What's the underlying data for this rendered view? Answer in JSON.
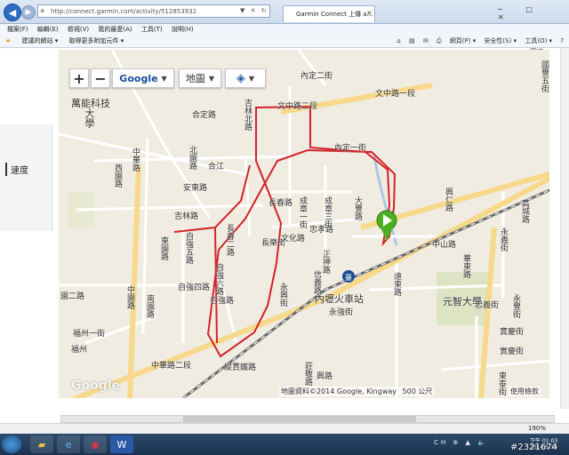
{
  "browser": {
    "address": "http://connect.garmin.com/activity/512853932",
    "tab_title": "Garmin Connect 上傳 a...",
    "tab_close": "×",
    "window_controls": "─ □ ✕",
    "address_controls": "▼ ✕ ↻"
  },
  "menu": [
    "檔案(F)",
    "編輯(E)",
    "檢視(V)",
    "我的最愛(A)",
    "工具(T)",
    "說明(H)"
  ],
  "favorites": [
    "建議的網站 ▾",
    "取得更多附加元件 ▾"
  ],
  "commandbar": [
    "網頁(P) ▾",
    "安全性(S) ▾",
    "工具(O) ▾",
    "?"
  ],
  "page": {
    "side_label": "速度",
    "top_label": "圖表"
  },
  "map": {
    "zoom_in": "+",
    "zoom_out": "−",
    "map_type": "Google",
    "map_view": "地圖",
    "watermark": "Google",
    "attribution": "地圖資料©2014 Google, Kingway",
    "scale": "500 公尺",
    "terms": "使用條款",
    "labels": [
      "萬能科技",
      "大學",
      "合定路",
      "合江",
      "北園路",
      "安東路",
      "吉林路",
      "西園路",
      "中華路",
      "東園路",
      "自強五路",
      "自強四路",
      "中園路",
      "南園路",
      "福州一街",
      "福州",
      "園二路",
      "吉林北路",
      "長春路",
      "長春二路",
      "自強六路",
      "長樂街",
      "文化路",
      "忠孝路",
      "正神路",
      "信義路",
      "成章一街",
      "成章三街",
      "大豐路",
      "內定二街",
      "內定一街",
      "文中路一段",
      "文中路二段",
      "中山路",
      "中華路二段",
      "縱貫鐵路",
      "內壢火車站",
      "永強街",
      "元智大學",
      "忠義街",
      "遠東路",
      "永興街",
      "寶慶街",
      "莊敬路",
      "永豐街",
      "實慶街",
      "東泰街",
      "興仁路",
      "高城路",
      "華東路",
      "永義街",
      "國豐五街",
      "興路",
      "自強路"
    ]
  },
  "status": {
    "zoom": "190%"
  },
  "taskbar": {
    "tray": "CH  ⊕  ▲  🔈",
    "time": "下午 01:03",
    "date": "2014/5/19",
    "stamp": "#2321674"
  },
  "colors": {
    "route": "#d2232a",
    "start_marker": "#4caf22",
    "road_major": "#f7d98b",
    "road_minor": "#ffffff",
    "rail": "#6a6a6a"
  }
}
